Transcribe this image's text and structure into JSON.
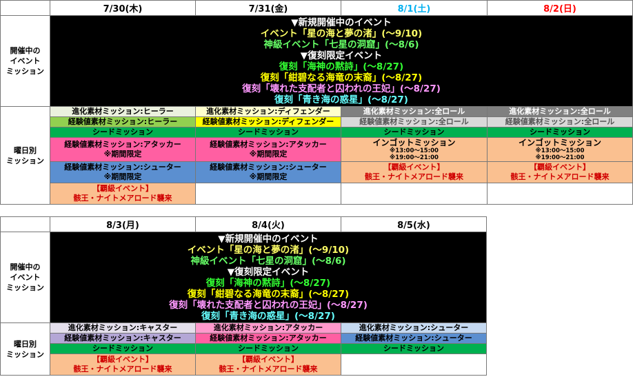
{
  "labels": {
    "event_mission": "開催中の\nイベント\nミッション",
    "weekday_mission": "曜日別\nミッション"
  },
  "events": {
    "new_heading": "▼新規開催中のイベント",
    "new_1": "イベント「星の海と夢の渚」(～9/10)",
    "new_2": "神級イベント「七星の洞窟」(～8/6)",
    "rerun_heading": "▼復刻限定イベント",
    "rerun_1": "復刻「海神の黙詩」(～8/27)",
    "rerun_2": "復刻「紺碧なる海竜の末裔」(～8/27)",
    "rerun_3": "復刻「壊れた支配者と囚われの王妃」(～8/27)",
    "rerun_4": "復刻「青き海の惑星」(～8/27)"
  },
  "colors": {
    "event_new_1": "#ffff66",
    "event_new_2": "#66ff66",
    "event_heading": "#ffffff",
    "rerun_1": "#33ff33",
    "rerun_2": "#ffff00",
    "rerun_3": "#ff99ff",
    "rerun_4": "#66ffff",
    "healer": "#92d050",
    "defender": "#ffff00",
    "all_role": "#808080",
    "all_role_exp": "#d9d9d9",
    "seed": "#00b050",
    "attacker": "#ff5fa2",
    "attacker_light": "#ff99cc",
    "shooter": "#5b8fd0",
    "shooter_light": "#c5d9f1",
    "caster": "#b4a7d6",
    "caster_light": "#e4dfec",
    "ingot": "#fac090",
    "defender_light": "#ffffcc",
    "healer_light": "#ebf1de",
    "date_weekday": "#000000",
    "date_saturday": "#00b0f0",
    "date_sunday": "#ff0000",
    "red_text": "#d00000"
  },
  "week1": {
    "dates": [
      "7/30(木)",
      "7/31(金)",
      "8/1(土)",
      "8/2(日)"
    ]
  },
  "week2": {
    "dates": [
      "8/3(月)",
      "8/4(火)",
      "8/5(水)"
    ]
  },
  "missions": {
    "evo_healer": "進化素材ミッション:ヒーラー",
    "exp_healer": "経験値素材ミッション:ヒーラー",
    "evo_defender": "進化素材ミッション:ディフェンダー",
    "exp_defender": "経験値素材ミッション:ディフェンダー",
    "evo_all": "進化素材ミッション:全ロール",
    "exp_all": "経験値素材ミッション:全ロール",
    "evo_caster": "進化素材ミッション:キャスター",
    "exp_caster": "経験値素材ミッション:キャスター",
    "evo_attacker": "進化素材ミッション:アタッカー",
    "exp_attacker": "経験値素材ミッション:アタッカー",
    "evo_shooter": "進化素材ミッション:シューター",
    "exp_shooter": "経験値素材ミッション:シューター",
    "seed": "シードミッション",
    "limited": "※期間限定",
    "ingot": "インゴットミッション",
    "ingot_time1": "※13:00～15:00",
    "ingot_time2": "※19:00～21:00",
    "hagyu_tag": "【覇級イベント】",
    "hagyu_name": "骸王・ナイトメアロード襲来"
  }
}
